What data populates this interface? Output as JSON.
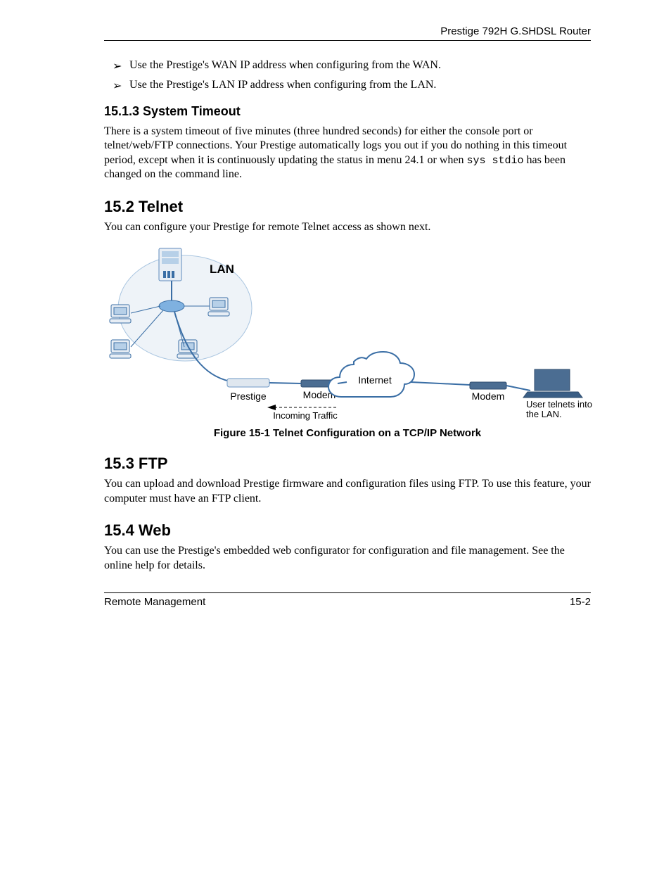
{
  "header": {
    "title": "Prestige 792H G.SHDSL Router"
  },
  "bullets": [
    "Use the Prestige's WAN IP address when configuring from the WAN.",
    "Use the Prestige's LAN IP address when configuring from the LAN."
  ],
  "s1": {
    "heading": "15.1.3  System Timeout",
    "para_a": "There is a system timeout of five minutes (three hundred seconds) for either the console port or telnet/web/FTP connections. Your Prestige automatically logs you out if you do nothing in this timeout period, except when it is continuously updating the status in menu 24.1 or when ",
    "code": "sys stdio",
    "para_b": " has been changed on the command line."
  },
  "s2": {
    "heading": "15.2  Telnet",
    "para": "You can configure your Prestige for remote Telnet access as shown next.",
    "figure": {
      "caption": "Figure 15-1 Telnet Configuration on a TCP/IP Network",
      "labels": {
        "lan": "LAN",
        "prestige": "Prestige",
        "modem1": "Modem",
        "modem2": "Modem",
        "internet": "Internet",
        "incoming": "Incoming Traffic",
        "user": "User telnets into the LAN."
      }
    }
  },
  "s3": {
    "heading": "15.3  FTP",
    "para": "You can upload and download Prestige firmware and configuration files using FTP. To use this feature, your computer must have an FTP client."
  },
  "s4": {
    "heading": "15.4  Web",
    "para": "You can use the Prestige's embedded web configurator for configuration and file management. See the online help for details."
  },
  "footer": {
    "left": "Remote Management",
    "right": "15-2"
  }
}
